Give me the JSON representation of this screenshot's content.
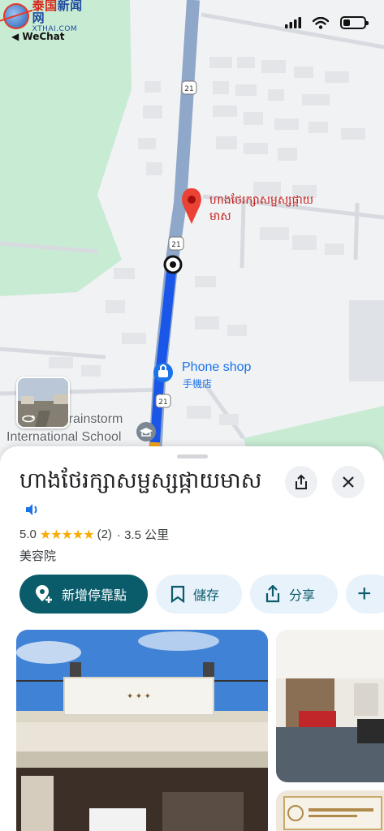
{
  "status_bar": {
    "watermark_cn_red": "泰国",
    "watermark_cn_blue": "新闻网",
    "watermark_url": "XTHAI.COM",
    "back_label": "◀ WeChat",
    "icons": [
      "signal-icon",
      "wifi-icon",
      "battery-icon"
    ]
  },
  "map": {
    "route_shield": "21",
    "place_label": "ហាងថែរក្សាសម្ផស្សផ្កាយមាស",
    "poi_phone_shop": "Phone shop",
    "poi_phone_shop_sub": "手機店",
    "school_label_line1": "Brainstorm",
    "school_label_line2": "International School",
    "colors": {
      "route": "#1a56e8",
      "road": "#8fa7c9",
      "pin": "#ea4335",
      "park": "#c8ebd4"
    }
  },
  "sheet": {
    "title": "ហាងថែរក្សាសម្ផស្សផ្កាយមាស",
    "rating_value": "5.0",
    "stars": "★★★★★",
    "review_count": "(2)",
    "distance": "· 3.5 公里",
    "category": "美容院",
    "actions": {
      "add_stop": "新增停靠點",
      "save": "儲存",
      "share": "分享",
      "more": "+"
    },
    "accent": "#0b5c6b"
  }
}
